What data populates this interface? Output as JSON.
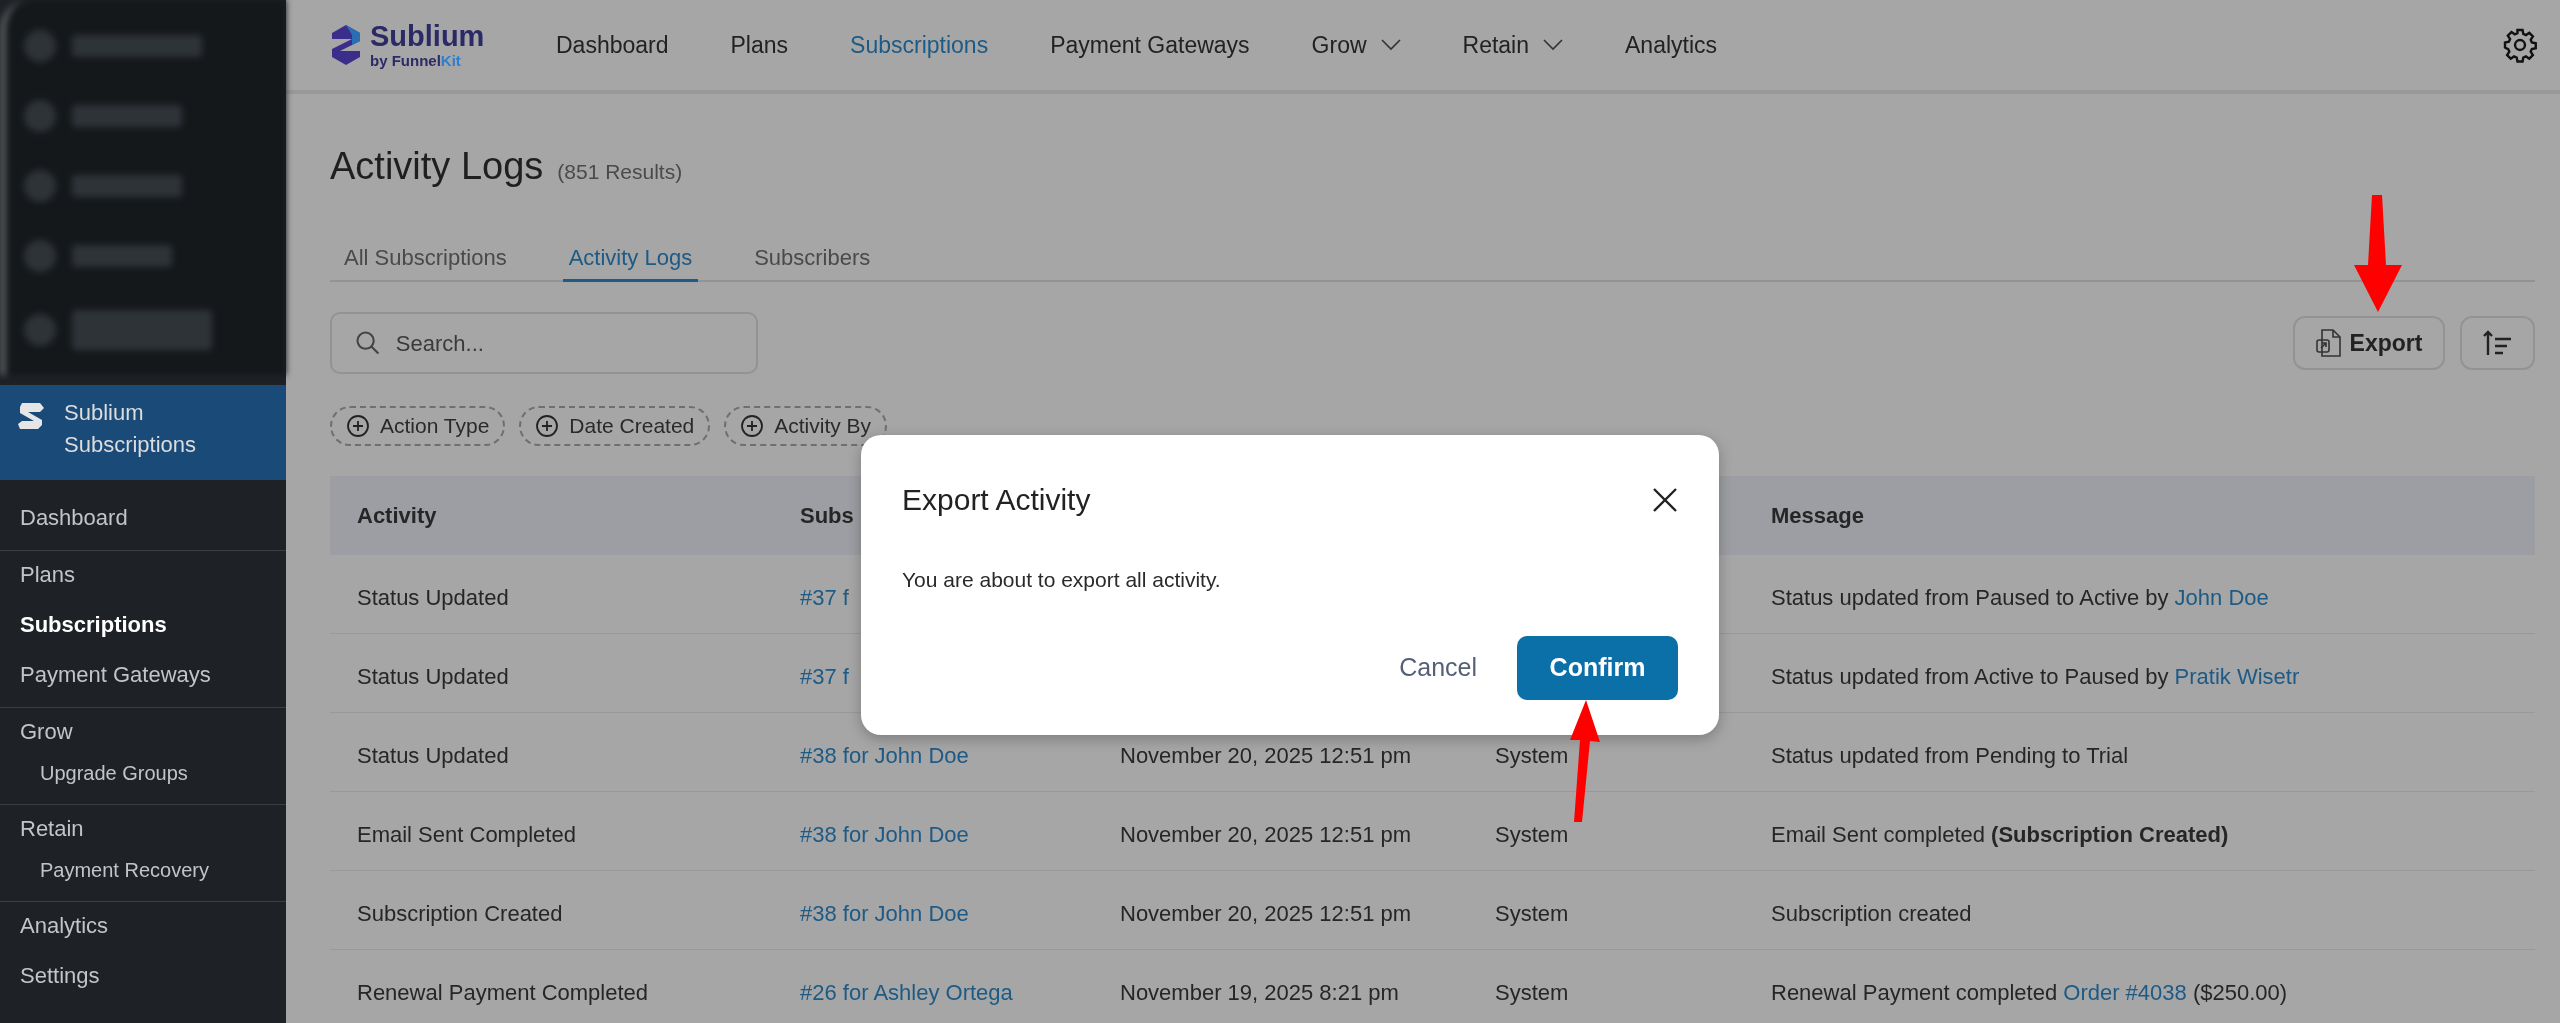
{
  "sidebar": {
    "app_title": "Sublium Subscriptions",
    "groups": [
      [
        {
          "label": "Dashboard",
          "selected": false
        }
      ],
      [
        {
          "label": "Plans",
          "selected": false
        },
        {
          "label": "Subscriptions",
          "selected": true
        },
        {
          "label": "Payment Gateways",
          "selected": false
        }
      ],
      [
        {
          "label": "Grow",
          "selected": false,
          "children": [
            {
              "label": "Upgrade Groups",
              "selected": false
            }
          ]
        }
      ],
      [
        {
          "label": "Retain",
          "selected": false,
          "children": [
            {
              "label": "Payment Recovery",
              "selected": false
            }
          ]
        }
      ],
      [
        {
          "label": "Analytics",
          "selected": false
        },
        {
          "label": "Settings",
          "selected": false
        }
      ]
    ]
  },
  "header": {
    "logo": {
      "name": "Sublium",
      "tagline": [
        {
          "text": "by Funnel",
          "accent": false
        },
        {
          "text": "Kit",
          "accent": true
        }
      ]
    },
    "nav": [
      {
        "label": "Dashboard",
        "selected": false,
        "dropdown": false
      },
      {
        "label": "Plans",
        "selected": false,
        "dropdown": false
      },
      {
        "label": "Subscriptions",
        "selected": true,
        "dropdown": false
      },
      {
        "label": "Payment Gateways",
        "selected": false,
        "dropdown": false
      },
      {
        "label": "Grow",
        "selected": false,
        "dropdown": true
      },
      {
        "label": "Retain",
        "selected": false,
        "dropdown": true
      },
      {
        "label": "Analytics",
        "selected": false,
        "dropdown": false
      }
    ]
  },
  "page": {
    "title": "Activity Logs",
    "count": "(851 Results)",
    "tabs": [
      {
        "label": "All Subscriptions",
        "selected": false
      },
      {
        "label": "Activity Logs",
        "selected": true
      },
      {
        "label": "Subscribers",
        "selected": false
      }
    ],
    "search": {
      "placeholder": "Search..."
    },
    "export_button": "Export",
    "filters": [
      "Action Type",
      "Date Created",
      "Activity By"
    ]
  },
  "table": {
    "columns": {
      "activity": "Activity",
      "subscription": "Subs",
      "message": "Message"
    },
    "rows": [
      {
        "activity": "Status Updated",
        "subscription": "#37 f",
        "message": [
          {
            "text": "Status updated from Paused to Active by ",
            "link": false
          },
          {
            "text": "John Doe",
            "link": true
          }
        ]
      },
      {
        "activity": "Status Updated",
        "subscription": "#37 f",
        "message": [
          {
            "text": "Status updated from Active to Paused by ",
            "link": false
          },
          {
            "text": "Pratik Wisetr",
            "link": true
          }
        ]
      },
      {
        "activity": "Status Updated",
        "subscription": "#38 for John Doe",
        "date": "November 20, 2025 12:51 pm",
        "by": "System",
        "message": [
          {
            "text": "Status updated from Pending to Trial",
            "link": false
          }
        ]
      },
      {
        "activity": "Email Sent Completed",
        "subscription": "#38 for John Doe",
        "date": "November 20, 2025 12:51 pm",
        "by": "System",
        "message": [
          {
            "text": "Email Sent completed **(Subscription Created)**",
            "link": false
          }
        ]
      },
      {
        "activity": "Subscription Created",
        "subscription": "#38 for John Doe",
        "date": "November 20, 2025 12:51 pm",
        "by": "System",
        "message": [
          {
            "text": "Subscription created",
            "link": false
          }
        ]
      },
      {
        "activity": "Renewal Payment Completed",
        "subscription": "#26 for Ashley Ortega",
        "date": "November 19, 2025 8:21 pm",
        "by": "System",
        "message": [
          {
            "text": "Renewal Payment completed ",
            "link": false
          },
          {
            "text": "Order #4038",
            "link": true
          },
          {
            "text": " ($250.00)",
            "link": false
          }
        ]
      }
    ]
  },
  "modal": {
    "title": "Export Activity",
    "body": "You are about to export all activity.",
    "cancel": "Cancel",
    "confirm": "Confirm"
  }
}
